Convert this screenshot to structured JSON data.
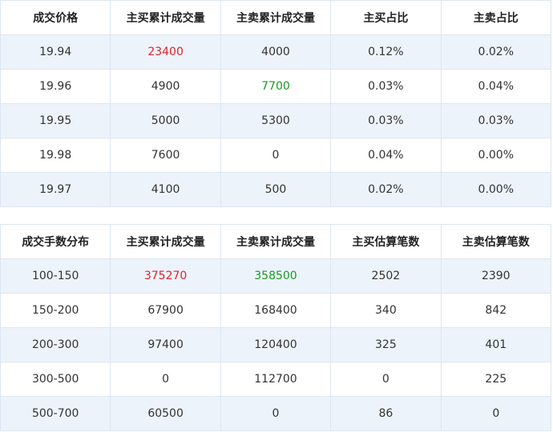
{
  "price_table": {
    "headers": [
      "成交价格",
      "主买累计成交量",
      "主卖累计成交量",
      "主买占比",
      "主卖占比"
    ],
    "rows": [
      [
        "19.94",
        "23400",
        "4000",
        "0.12%",
        "0.02%"
      ],
      [
        "19.96",
        "4900",
        "7700",
        "0.03%",
        "0.04%"
      ],
      [
        "19.95",
        "5000",
        "5300",
        "0.03%",
        "0.03%"
      ],
      [
        "19.98",
        "7600",
        "0",
        "0.04%",
        "0.00%"
      ],
      [
        "19.97",
        "4100",
        "500",
        "0.02%",
        "0.00%"
      ]
    ]
  },
  "lot_table": {
    "headers": [
      "成交手数分布",
      "主买累计成交量",
      "主卖累计成交量",
      "主买估算笔数",
      "主卖估算笔数"
    ],
    "rows": [
      [
        "100-150",
        "375270",
        "358500",
        "2502",
        "2390"
      ],
      [
        "150-200",
        "67900",
        "168400",
        "340",
        "842"
      ],
      [
        "200-300",
        "97400",
        "120400",
        "325",
        "401"
      ],
      [
        "300-500",
        "0",
        "112700",
        "0",
        "225"
      ],
      [
        "500-700",
        "60500",
        "0",
        "86",
        "0"
      ]
    ]
  },
  "colors": {
    "row_stripe": "#edf3fb",
    "border": "#dce6f2",
    "highlight_buy": "#e0232a",
    "highlight_sell": "#1a9a22"
  }
}
